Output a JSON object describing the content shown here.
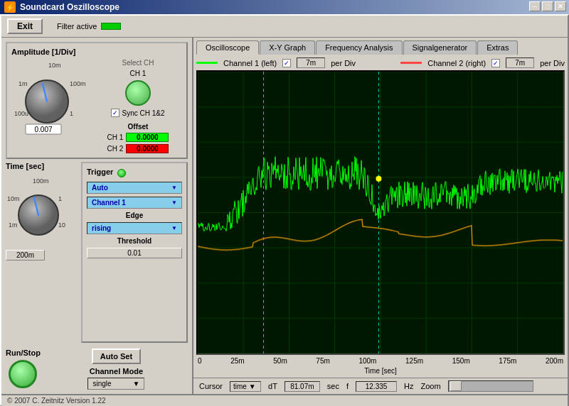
{
  "window": {
    "title": "Soundcard Oszilloscope",
    "minimize": "─",
    "maximize": "□",
    "close": "✕"
  },
  "top_bar": {
    "exit_label": "Exit",
    "filter_label": "Filter active"
  },
  "amplitude": {
    "title": "Amplitude [1/Div]",
    "value": "0.007",
    "labels": [
      "10m",
      "100m",
      "1",
      "100u",
      "1m"
    ],
    "select_ch_label": "Select CH",
    "ch1_label": "CH 1",
    "sync_label": "Sync CH 1&2",
    "offset_label": "Offset",
    "ch1_offset": "0.0000",
    "ch2_offset": "0.0000",
    "ch1_row_label": "CH 1",
    "ch2_row_label": "CH 2"
  },
  "time": {
    "title": "Time [sec]",
    "value": "200m",
    "labels": [
      "100m",
      "1",
      "10",
      "10m",
      "1m"
    ]
  },
  "trigger": {
    "title": "Trigger",
    "mode": "Auto",
    "channel": "Channel 1",
    "edge_label": "Edge",
    "edge_value": "rising",
    "threshold_label": "Threshold",
    "threshold_value": "0.01",
    "auto_set_label": "Auto Set"
  },
  "channel_mode": {
    "label": "Channel Mode",
    "value": "single"
  },
  "run_stop": {
    "label": "Run/Stop"
  },
  "tabs": [
    {
      "label": "Oscilloscope",
      "active": true
    },
    {
      "label": "X-Y Graph",
      "active": false
    },
    {
      "label": "Frequency Analysis",
      "active": false
    },
    {
      "label": "Signalgenerator",
      "active": false
    },
    {
      "label": "Extras",
      "active": false
    }
  ],
  "channel_bar": {
    "ch1_label": "Channel 1 (left)",
    "ch1_per_div": "7m",
    "ch1_per_div_label": "per Div",
    "ch2_label": "Channel 2 (right)",
    "ch2_per_div": "7m",
    "ch2_per_div_label": "per Div"
  },
  "scope": {
    "x_labels": [
      "0",
      "25m",
      "50m",
      "75m",
      "100m",
      "125m",
      "150m",
      "175m",
      "200m"
    ],
    "x_axis_label": "Time [sec]"
  },
  "cursor": {
    "label": "Cursor",
    "type": "time",
    "dt_label": "dT",
    "dt_value": "81.07m",
    "dt_unit": "sec",
    "f_label": "f",
    "f_value": "12.335",
    "f_unit": "Hz",
    "zoom_label": "Zoom"
  },
  "status_bar": {
    "text": "© 2007  C. Zeitnitz  Version 1.22"
  }
}
